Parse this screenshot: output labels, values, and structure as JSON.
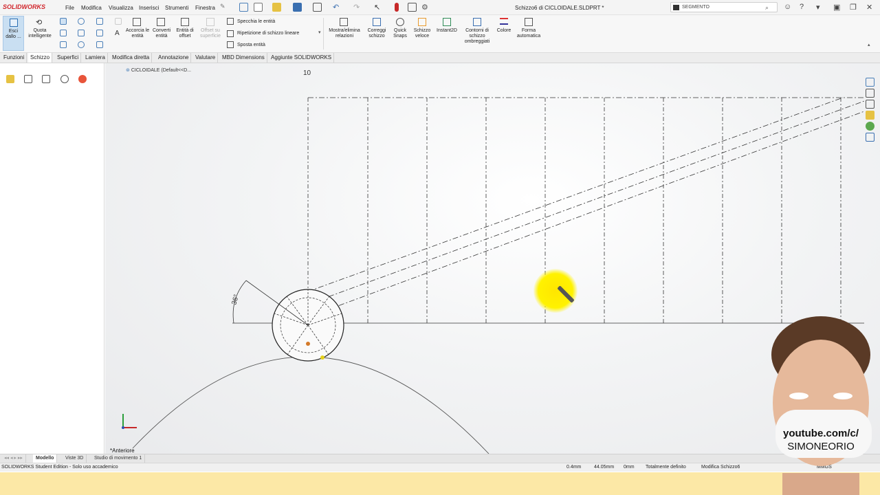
{
  "app": {
    "logo": "SOLIDWORKS",
    "menu": [
      "File",
      "Modifica",
      "Visualizza",
      "Inserisci",
      "Strumenti",
      "Finestra"
    ],
    "document_title": "Schizzo6 di CICLOIDALE.SLDPRT *",
    "search_placeholder": "SEGMENTO"
  },
  "ribbon": {
    "exit_sketch": "Esci dallo ...",
    "smart_dimension": "Quota intelligente",
    "trim": "Accorcia le entità",
    "convert": "Converti entità",
    "offset": "Entità di offset",
    "offset_surface": "Offset su superficie",
    "mirror": "Specchia le entità",
    "linear_pattern": "Ripetizione di schizzo lineare",
    "move": "Sposta entità",
    "relations": "Mostra/elimina relazioni",
    "repair": "Correggi schizzo",
    "quick_snaps": "Quick Snaps",
    "rapid_sketch": "Schizzo veloce",
    "instant2d": "Instant2D",
    "shaded_contours": "Contorni di schizzo ombreggiati",
    "color": "Colore",
    "auto_shape": "Forma automatica"
  },
  "tabs": [
    "Funzioni",
    "Schizzo",
    "Superfici",
    "Lamiera",
    "Modifica diretta",
    "Annotazione",
    "Valutare",
    "MBD Dimensions",
    "Aggiunte SOLIDWORKS"
  ],
  "active_tab": "Schizzo",
  "tree": {
    "root": "CICLOIDALE  (Default<<D..."
  },
  "viewport": {
    "dimension_top": "10",
    "angle_dimension": "36°",
    "orientation": "*Anteriore"
  },
  "bottom_tabs": [
    "Modello",
    "Viste 3D",
    "Studio di movimento 1"
  ],
  "status": {
    "edition": "SOLIDWORKS Student Edition - Solo uso accademico",
    "x": "0.4mm",
    "y": "44.05mm",
    "z": "0mm",
    "state": "Totalmente definito",
    "mode": "Modifica Schizzo6",
    "units": "MMGS"
  },
  "overlay": {
    "channel_line1": "youtube.com/c/",
    "channel_line2": "SIMONEORIO"
  },
  "colors": {
    "brand_red": "#d1262c",
    "cursor_highlight": "#fff200",
    "status_strip": "#fce8a6"
  }
}
